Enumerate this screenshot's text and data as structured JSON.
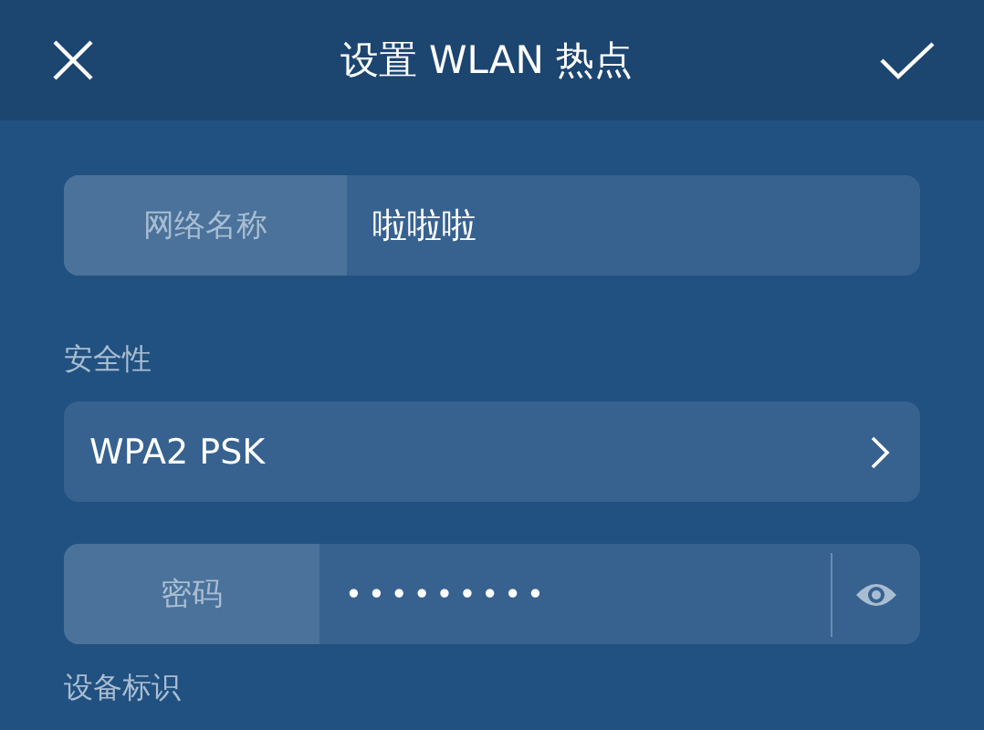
{
  "header": {
    "title": "设置 WLAN 热点"
  },
  "network_name": {
    "label": "网络名称",
    "value": "啦啦啦"
  },
  "security": {
    "label": "安全性",
    "value": "WPA2 PSK"
  },
  "password": {
    "label": "密码",
    "value": "•••••••••"
  },
  "device_id": {
    "label": "设备标识"
  }
}
